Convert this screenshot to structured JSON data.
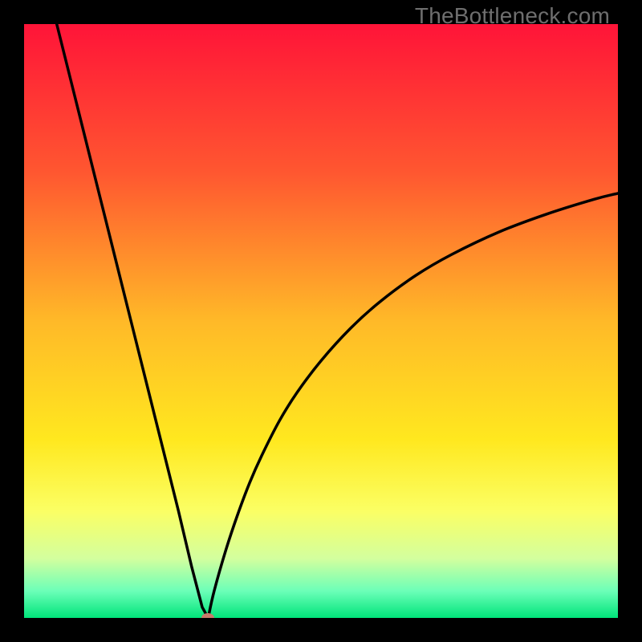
{
  "watermark": {
    "text": "TheBottleneck.com"
  },
  "chart_data": {
    "type": "line",
    "title": "",
    "xlabel": "",
    "ylabel": "",
    "xlim": [
      0,
      100
    ],
    "ylim": [
      0,
      100
    ],
    "gradient_colors": [
      {
        "stop": 0.0,
        "color": "#ff1438"
      },
      {
        "stop": 0.25,
        "color": "#ff5730"
      },
      {
        "stop": 0.5,
        "color": "#ffb928"
      },
      {
        "stop": 0.7,
        "color": "#ffe81f"
      },
      {
        "stop": 0.82,
        "color": "#fbff64"
      },
      {
        "stop": 0.9,
        "color": "#d3ff9e"
      },
      {
        "stop": 0.955,
        "color": "#6bffb8"
      },
      {
        "stop": 1.0,
        "color": "#00e47a"
      }
    ],
    "series": [
      {
        "name": "left-branch",
        "x": [
          5.5,
          8,
          10,
          12,
          14,
          16,
          18,
          20,
          22,
          24,
          26,
          28.25,
          30,
          31
        ],
        "y": [
          100,
          90,
          82,
          74,
          66,
          58,
          50,
          42,
          34,
          26,
          18,
          8.5,
          1.8,
          0
        ]
      },
      {
        "name": "right-branch",
        "x": [
          31,
          32,
          34,
          36,
          38,
          40,
          43,
          46,
          50,
          55,
          60,
          66,
          72,
          80,
          88,
          96,
          100
        ],
        "y": [
          0,
          4.5,
          11.5,
          17.5,
          22.8,
          27.3,
          33.2,
          38,
          43.3,
          48.8,
          53.3,
          57.7,
          61.2,
          65,
          68,
          70.5,
          71.5
        ]
      }
    ],
    "marker": {
      "x": 31,
      "y": 0,
      "color": "#c97a6b"
    }
  }
}
